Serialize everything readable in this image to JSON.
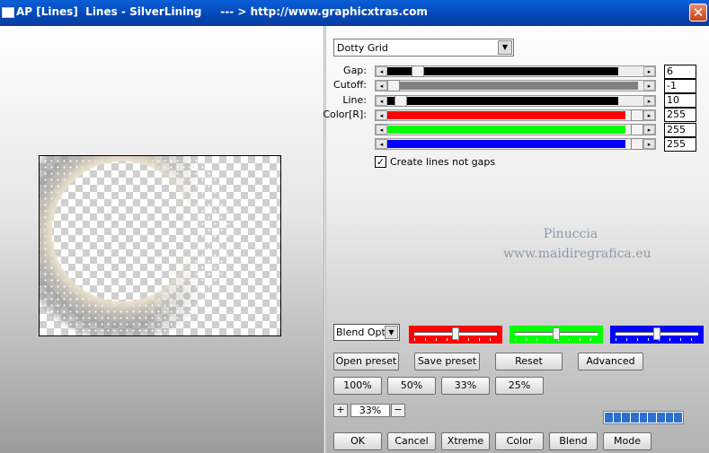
{
  "window": {
    "title": "AP [Lines]  Lines - SilverLining     --- > http://www.graphicxtras.com",
    "close_label": "✕"
  },
  "preset_dropdown": {
    "value": "Dotty Grid"
  },
  "sliders": [
    {
      "label": "Gap:",
      "value": "6",
      "fill": 0.9,
      "color": "#000000",
      "level": 0.1
    },
    {
      "label": "Cutoff:",
      "value": "-1",
      "fill": 0.98,
      "color": "#808080",
      "level": 0.0
    },
    {
      "label": "Line:",
      "value": "10",
      "fill": 0.9,
      "color": "#000000",
      "level": 0.03
    },
    {
      "label": "Color[R]:",
      "value": "255",
      "fill": 0.93,
      "color": "#ff0000",
      "level": 1.0
    },
    {
      "label": "",
      "value": "255",
      "fill": 0.93,
      "color": "#00ff00",
      "level": 1.0
    },
    {
      "label": "",
      "value": "255",
      "fill": 0.93,
      "color": "#0000ff",
      "level": 1.0
    }
  ],
  "checkbox": {
    "label": "Create lines not gaps",
    "checked": true,
    "mark": "✓"
  },
  "watermark": {
    "line1": "Pinuccia",
    "line2": "www.maidiregrafica.eu"
  },
  "blend_select": {
    "value": "Blend Options"
  },
  "color_sliders": [
    {
      "color": "#ff0000",
      "level": 0.5
    },
    {
      "color": "#00ff00",
      "level": 0.5
    },
    {
      "color": "#0000ff",
      "level": 0.5
    }
  ],
  "buttons_row1": [
    "Open preset",
    "Save preset",
    "Reset",
    "Advanced"
  ],
  "zoom_buttons": [
    "100%",
    "50%",
    "33%",
    "25%"
  ],
  "zoom": {
    "value": "33%",
    "plus": "+",
    "minus": "−"
  },
  "bottom_buttons": [
    "OK",
    "Cancel",
    "Xtreme",
    "Color",
    "Blend",
    "Mode"
  ],
  "progress": {
    "segments": 9,
    "level": 1.0,
    "color": "#2f6fd0"
  }
}
